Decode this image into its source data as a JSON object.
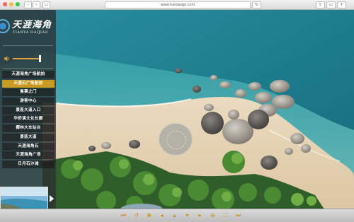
{
  "browser": {
    "url": "www.haidaogo.com",
    "back_glyph": "‹",
    "forward_glyph": "›",
    "tabs_glyph": "▭",
    "reload_glyph": "↻",
    "share_glyph": "⇪",
    "newtab_glyph": "+"
  },
  "logo": {
    "title": "天涯海角",
    "subtitle": "TIANYA HAIJIAO"
  },
  "audio": {
    "volume": 0.9
  },
  "menu": {
    "items": [
      {
        "label": "天涯海角广场航拍",
        "active": false
      },
      {
        "label": "天涯石广场航拍",
        "active": true
      },
      {
        "label": "售票之门",
        "active": false
      },
      {
        "label": "游客中心",
        "active": false
      },
      {
        "label": "景區大道入口",
        "active": false
      },
      {
        "label": "华侨演文化长廊",
        "active": false
      },
      {
        "label": "椰林大车站台",
        "active": false
      },
      {
        "label": "景區大道",
        "active": false
      },
      {
        "label": "天涯海角石",
        "active": false
      },
      {
        "label": "天涯海角广场",
        "active": false
      },
      {
        "label": "日月石沙滩",
        "active": false
      }
    ]
  },
  "toolbar": {
    "tools": [
      {
        "icon": "skip-back-icon",
        "glyph": "⏮"
      },
      {
        "icon": "rotate-left-icon",
        "glyph": "↺"
      },
      {
        "icon": "zoom-in-icon",
        "glyph": "⊕"
      },
      {
        "icon": "arrow-left-icon",
        "glyph": "◂"
      },
      {
        "icon": "arrow-up-icon",
        "glyph": "▴"
      },
      {
        "icon": "arrow-down-icon",
        "glyph": "▾"
      },
      {
        "icon": "arrow-right-icon",
        "glyph": "▸"
      },
      {
        "icon": "zoom-out-icon",
        "glyph": "⊖"
      },
      {
        "icon": "fullscreen-icon",
        "glyph": "⛶"
      },
      {
        "icon": "skip-forward-icon",
        "glyph": "⏭"
      }
    ]
  },
  "colors": {
    "accent": "#c99a22",
    "sea_deep": "#1f7f8e",
    "sea_shallow": "#5ec4c0",
    "sand": "#e6d3b4"
  }
}
